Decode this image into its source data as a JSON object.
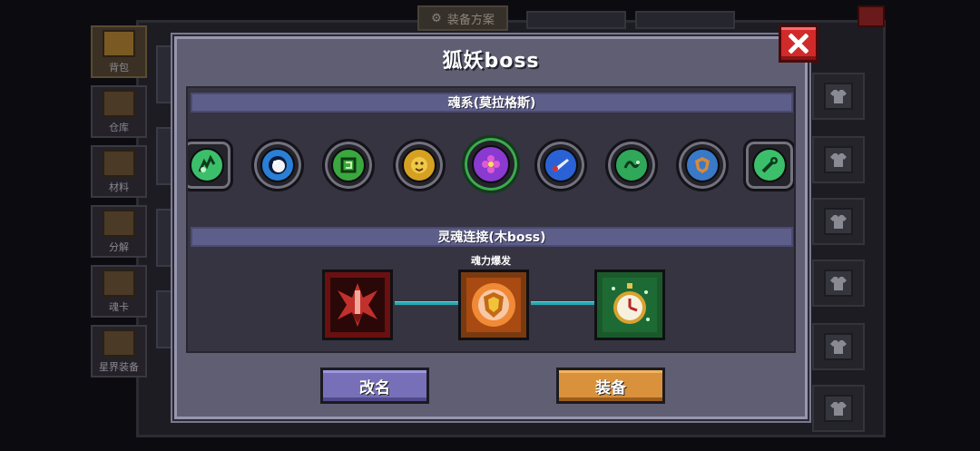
{
  "background": {
    "top_button": "装备方案",
    "tabs": [
      {
        "label": "背包",
        "active": true
      },
      {
        "label": "仓库",
        "active": false
      },
      {
        "label": "材料",
        "active": false
      },
      {
        "label": "分解",
        "active": false
      },
      {
        "label": "魂卡",
        "active": false
      },
      {
        "label": "星界装备",
        "active": false
      }
    ],
    "equip_slot_icon": "shirt-icon"
  },
  "dialog": {
    "title": "狐妖boss",
    "rune_section_title": "魂系(莫拉格斯)",
    "runes": [
      {
        "icon": "green-claw-rune",
        "color": "#3cbf6a"
      },
      {
        "icon": "eyeball-rune",
        "color": "#2a7fd6"
      },
      {
        "icon": "green-glyph-rune",
        "color": "#3aa83e"
      },
      {
        "icon": "gold-lion-rune",
        "color": "#d6a022"
      },
      {
        "icon": "purple-flower-rune",
        "color": "#8a3ad0"
      },
      {
        "icon": "blue-blade-rune",
        "color": "#2a62d6"
      },
      {
        "icon": "green-serpent-rune",
        "color": "#2fa85a"
      },
      {
        "icon": "blue-shield-rune",
        "color": "#3a78c8"
      },
      {
        "icon": "green-wrench-rune",
        "color": "#3cbf6a"
      }
    ],
    "link_section_title": "灵魂连接(木boss)",
    "burst_label": "魂力爆发",
    "soul_links": [
      {
        "icon": "red-winged-blade-icon",
        "color": "#b8242a"
      },
      {
        "icon": "orange-shield-icon",
        "color": "#e87a22"
      },
      {
        "icon": "green-stopwatch-icon",
        "color": "#2ca850"
      }
    ],
    "link_color": "#2ca6b0",
    "rename_label": "改名",
    "equip_label": "装备",
    "accent_purple": "#7770b8",
    "accent_orange": "#d9913b",
    "close_color": "#d12a2a"
  }
}
